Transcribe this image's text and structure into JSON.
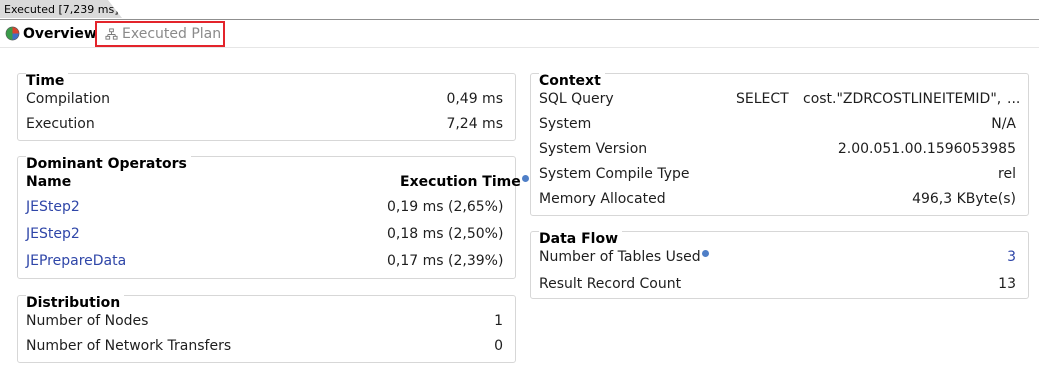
{
  "editor_tab": {
    "label": "Executed [7,239 ms]"
  },
  "subtabs": {
    "overview": "Overview",
    "executed_plan": "Executed Plan"
  },
  "time": {
    "title": "Time",
    "rows": [
      {
        "label": "Compilation",
        "value": "0,49 ms"
      },
      {
        "label": "Execution",
        "value": "7,24 ms"
      }
    ]
  },
  "dominant": {
    "title": "Dominant Operators",
    "col_name": "Name",
    "col_time": "Execution Time",
    "rows": [
      {
        "name": "JEStep2",
        "time": "0,19 ms (2,65%)"
      },
      {
        "name": "JEStep2",
        "time": "0,18 ms (2,50%)"
      },
      {
        "name": "JEPrepareData",
        "time": "0,17 ms (2,39%)"
      }
    ]
  },
  "distribution": {
    "title": "Distribution",
    "rows": [
      {
        "label": "Number of Nodes",
        "value": "1"
      },
      {
        "label": "Number of Network Transfers",
        "value": "0"
      }
    ]
  },
  "context": {
    "title": "Context",
    "sql_label": "SQL Query",
    "sql_select": "SELECT",
    "sql_value": "cost.\"ZDRCOSTLINEITEMID\",",
    "sql_more": "...",
    "rows": [
      {
        "label": "System",
        "value": "N/A"
      },
      {
        "label": "System Version",
        "value": "2.00.051.00.1596053985"
      },
      {
        "label": "System Compile Type",
        "value": "rel"
      },
      {
        "label": "Memory Allocated",
        "value": "496,3 KByte(s)"
      }
    ]
  },
  "dataflow": {
    "title": "Data Flow",
    "rows": [
      {
        "label": "Number of Tables Used",
        "value": "3"
      },
      {
        "label": "Result Record Count",
        "value": "13"
      }
    ]
  },
  "colors": {
    "link": "#2f46a8",
    "highlight_border": "#e3242b",
    "info": "#4f7fc7"
  }
}
